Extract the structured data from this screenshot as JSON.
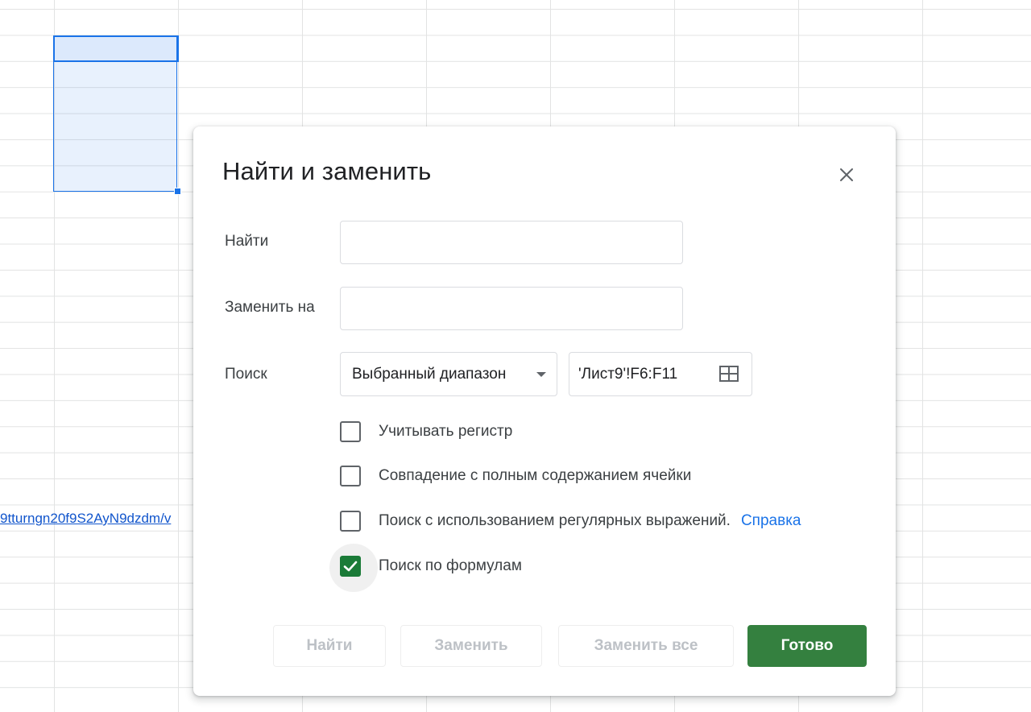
{
  "sheet": {
    "link_text": "9tturngn20f9S2AyN9dzdm/v"
  },
  "dialog": {
    "title": "Найти и заменить",
    "find": {
      "label": "Найти",
      "value": "",
      "placeholder": ""
    },
    "replace": {
      "label": "Заменить на",
      "value": "",
      "placeholder": ""
    },
    "search": {
      "label": "Поиск",
      "selected_option": "Выбранный диапазон",
      "range": "'Лист9'!F6:F11"
    },
    "options": [
      {
        "label": "Учитывать регистр",
        "checked": false
      },
      {
        "label": "Совпадение с полным содержанием ячейки",
        "checked": false
      },
      {
        "label": "Поиск с использованием регулярных выражений.",
        "checked": false,
        "help_link": "Справка"
      },
      {
        "label": "Поиск по формулам",
        "checked": true
      }
    ],
    "buttons": {
      "find": "Найти",
      "replace": "Заменить",
      "replace_all": "Заменить все",
      "done": "Готово"
    }
  },
  "colors": {
    "accent_green": "#34803f",
    "link_blue": "#1a73e8",
    "selection_blue": "#1a73e8",
    "disabled_text": "#bdc1c6"
  },
  "icons": {
    "close": "close-icon",
    "dropdown": "caret-down-icon",
    "range_picker": "grid-icon",
    "check": "checkmark-icon"
  }
}
